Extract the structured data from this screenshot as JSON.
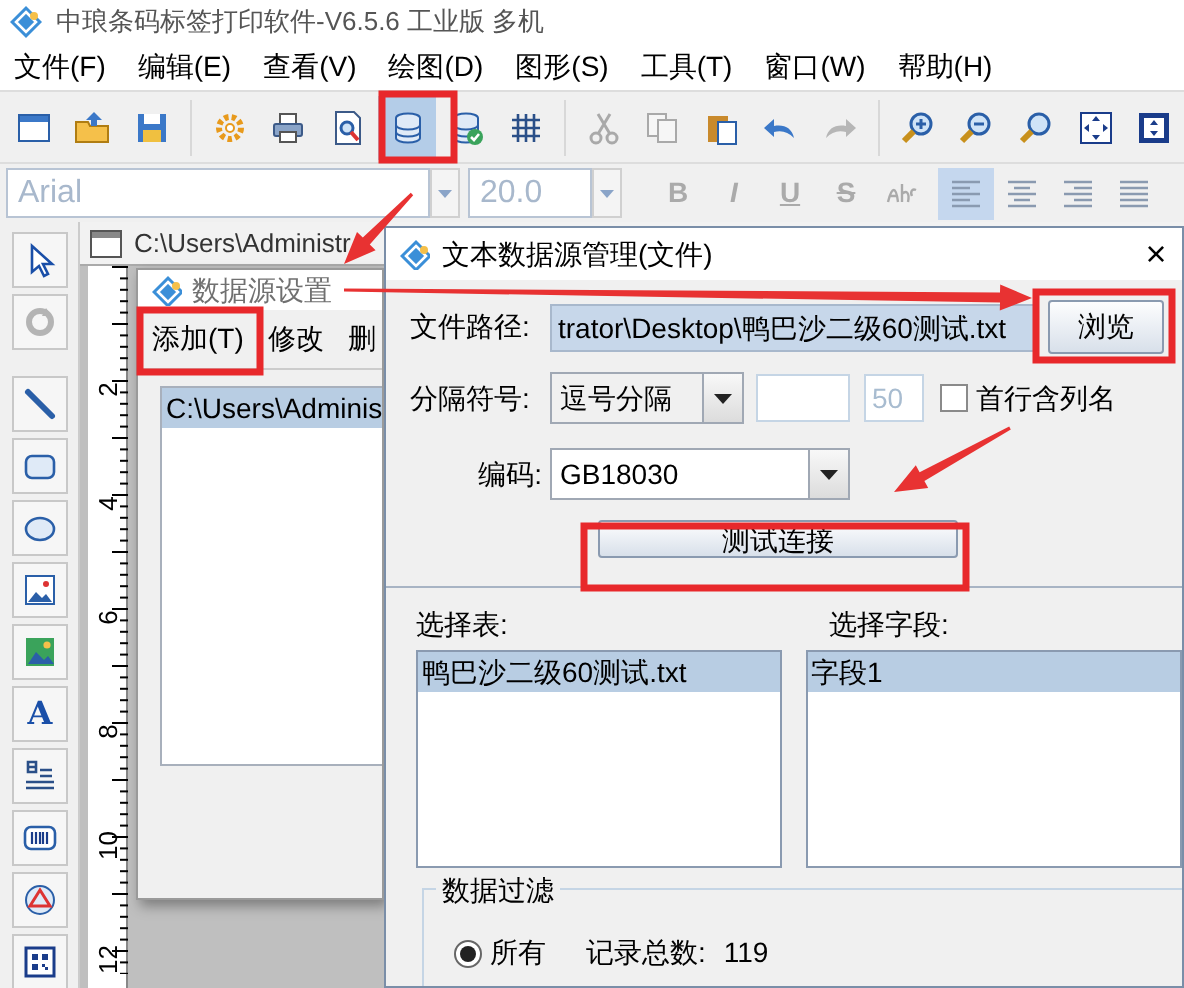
{
  "app": {
    "title": "中琅条码标签打印软件-V6.5.6 工业版 多机"
  },
  "menu": [
    "文件(F)",
    "编辑(E)",
    "查看(V)",
    "绘图(D)",
    "图形(S)",
    "工具(T)",
    "窗口(W)",
    "帮助(H)"
  ],
  "toolbar": [
    [
      {
        "selected": false,
        "disabled": false
      },
      {
        "selected": false,
        "disabled": false
      },
      {
        "selected": false,
        "disabled": false
      }
    ],
    [
      {
        "selected": false,
        "disabled": false
      },
      {
        "selected": false,
        "disabled": false
      },
      {
        "selected": false,
        "disabled": false
      },
      {
        "selected": true,
        "disabled": false
      },
      {
        "selected": false,
        "disabled": false
      },
      {
        "selected": false,
        "disabled": false
      }
    ],
    [
      {
        "selected": false,
        "disabled": true
      },
      {
        "selected": false,
        "disabled": true
      },
      {
        "selected": false,
        "disabled": false
      },
      {
        "selected": false,
        "disabled": false
      },
      {
        "selected": false,
        "disabled": true
      }
    ],
    [
      {
        "selected": false,
        "disabled": false
      },
      {
        "selected": false,
        "disabled": false
      },
      {
        "selected": false,
        "disabled": false
      },
      {
        "selected": false,
        "disabled": false
      },
      {
        "selected": false,
        "disabled": false
      }
    ]
  ],
  "format_bar": {
    "font": "Arial",
    "size": "20.0",
    "styles": [
      "B",
      "I",
      "U",
      "S"
    ],
    "align": [
      {
        "selected": true
      },
      {
        "selected": false
      },
      {
        "selected": false
      },
      {
        "selected": false
      }
    ]
  },
  "tools": [
    [
      {
        "disabled": false
      },
      {
        "disabled": true
      }
    ],
    [
      {
        "disabled": false
      },
      {
        "disabled": false
      },
      {
        "disabled": false
      },
      {
        "disabled": false
      },
      {
        "disabled": false
      },
      {
        "disabled": false,
        "label": "A"
      },
      {
        "disabled": false
      },
      {
        "disabled": false
      },
      {
        "disabled": false
      },
      {
        "disabled": false
      }
    ]
  ],
  "document": {
    "title": "C:\\Users\\Administr",
    "ruler": [
      "2",
      "4",
      "6",
      "8",
      "10",
      "12"
    ]
  },
  "data_source_dialog": {
    "title": "数据源设置",
    "actions": [
      "添加(T)",
      "修改",
      "删"
    ],
    "items": [
      {
        "text": "C:\\Users\\Adminis",
        "selected": true
      }
    ]
  },
  "text_source_dialog": {
    "title": "文本数据源管理(文件)",
    "close": "×",
    "path": {
      "label": "文件路径:",
      "value": "trator\\Desktop\\鸭巴沙二级60测试.txt"
    },
    "browse": "浏览",
    "separator": {
      "label": "分隔符号:",
      "value": "逗号分隔",
      "count": "50",
      "header_row": {
        "label": "首行含列名",
        "checked": false
      }
    },
    "encoding": {
      "label": "编码:",
      "value": "GB18030"
    },
    "test": "测试连接",
    "tables": {
      "label": "选择表:",
      "items": [
        {
          "text": "鸭巴沙二级60测试.txt",
          "selected": true
        }
      ]
    },
    "fields": {
      "label": "选择字段:",
      "items": [
        {
          "text": "字段1",
          "selected": true
        }
      ]
    },
    "filter": {
      "title": "数据过滤",
      "options": [
        {
          "label": "所有",
          "selected": true
        }
      ],
      "count_label": "记录总数:",
      "count": "119"
    }
  }
}
